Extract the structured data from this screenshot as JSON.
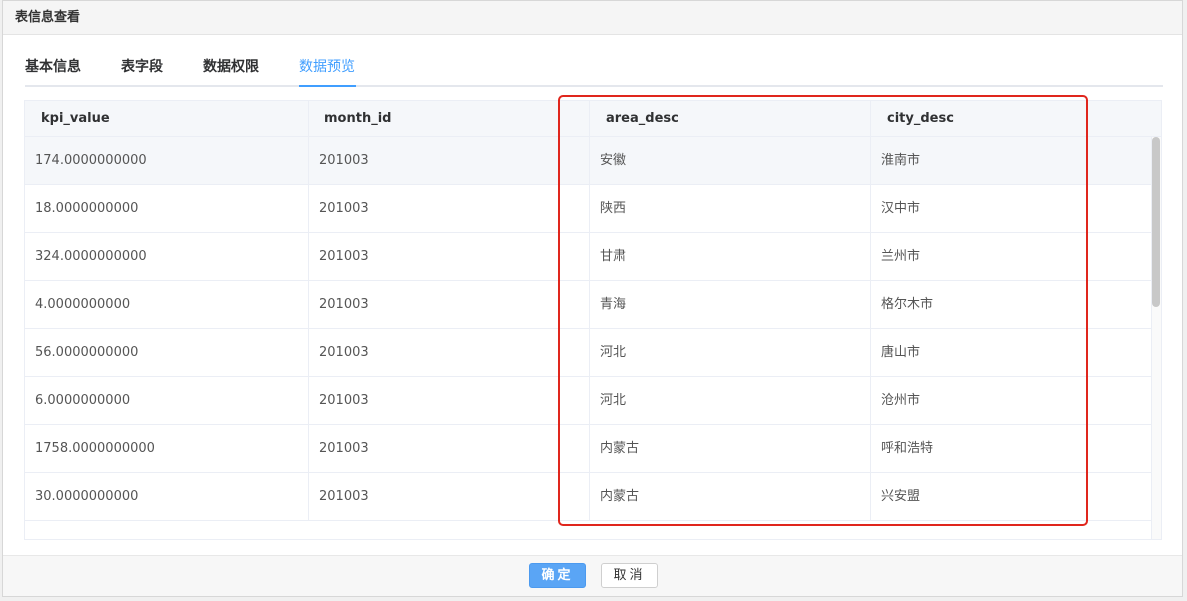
{
  "dialog": {
    "title": "表信息查看"
  },
  "tabs": [
    {
      "label": "基本信息",
      "active": false
    },
    {
      "label": "表字段",
      "active": false
    },
    {
      "label": "数据权限",
      "active": false
    },
    {
      "label": "数据预览",
      "active": true
    }
  ],
  "table": {
    "columns": [
      "kpi_value",
      "month_id",
      "area_desc",
      "city_desc"
    ],
    "rows": [
      [
        "174.0000000000",
        "201003",
        "安徽",
        "淮南市"
      ],
      [
        "18.0000000000",
        "201003",
        "陕西",
        "汉中市"
      ],
      [
        "324.0000000000",
        "201003",
        "甘肃",
        "兰州市"
      ],
      [
        "4.0000000000",
        "201003",
        "青海",
        "格尔木市"
      ],
      [
        "56.0000000000",
        "201003",
        "河北",
        "唐山市"
      ],
      [
        "6.0000000000",
        "201003",
        "河北",
        "沧州市"
      ],
      [
        "1758.0000000000",
        "201003",
        "内蒙古",
        "呼和浩特"
      ],
      [
        "30.0000000000",
        "201003",
        "内蒙古",
        "兴安盟"
      ]
    ]
  },
  "footer": {
    "confirm_label": "确定",
    "cancel_label": "取消"
  },
  "colors": {
    "accent": "#409eff",
    "highlight_box": "#e0261d",
    "primary_button": "#5aa5f5"
  }
}
